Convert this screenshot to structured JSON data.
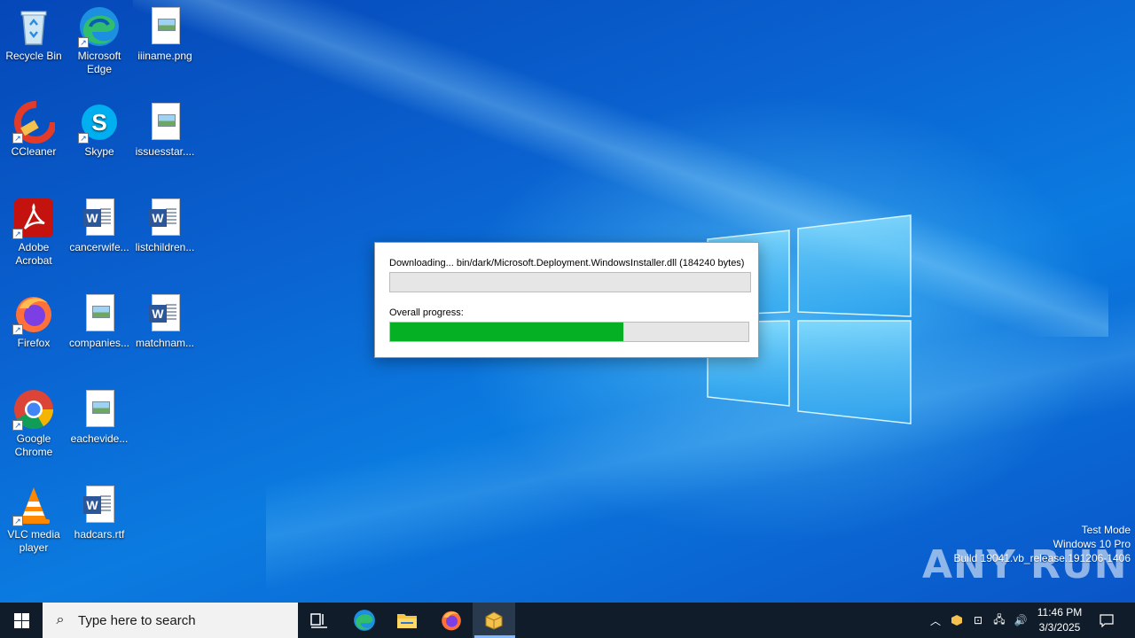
{
  "desktop": {
    "icons": [
      {
        "label": "Recycle Bin"
      },
      {
        "label": "Microsoft Edge"
      },
      {
        "label": "iiiname.png"
      },
      {
        "label": "CCleaner"
      },
      {
        "label": "Skype"
      },
      {
        "label": "issuesstar...."
      },
      {
        "label": "Adobe Acrobat"
      },
      {
        "label": "cancerwife..."
      },
      {
        "label": "listchildren..."
      },
      {
        "label": "Firefox"
      },
      {
        "label": "companies..."
      },
      {
        "label": "matchnam..."
      },
      {
        "label": "Google Chrome"
      },
      {
        "label": "eachevide..."
      },
      {
        "label": "VLC media player"
      },
      {
        "label": "hadcars.rtf"
      }
    ]
  },
  "dialog": {
    "download_text": "Downloading... bin/dark/Microsoft.Deployment.WindowsInstaller.dll (184240 bytes)",
    "file_progress": 0.0,
    "overall_label": "Overall progress:",
    "overall_progress": 0.65
  },
  "watermark": {
    "line1": "Test Mode",
    "line2": "Windows 10 Pro",
    "line3": "Build 19041.vb_release.191206-1406",
    "brand": "ANY RUN"
  },
  "taskbar": {
    "search_placeholder": "Type here to search",
    "time": "11:46 PM",
    "date": "3/3/2025"
  },
  "colors": {
    "progress_fill": "#06b025",
    "taskbar": "#101c2a"
  }
}
